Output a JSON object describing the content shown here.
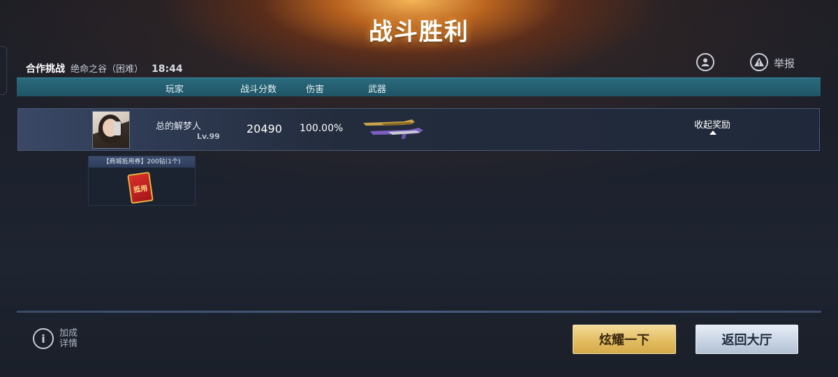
{
  "header": {
    "title": "战斗胜利",
    "mode": "合作挑战",
    "map": "绝命之谷（困难）",
    "time": "18:44",
    "report_label": "举报"
  },
  "columns": {
    "player": "玩家",
    "score": "战斗分数",
    "damage": "伤害",
    "weapon": "武器"
  },
  "player": {
    "name": "总的解梦人",
    "level": "Lv.99",
    "score": "20490",
    "damage": "100.00%",
    "collapse_label": "收起奖励"
  },
  "reward": {
    "title": "【商城抵用券】200钻(1个)",
    "coupon_text": "抵用"
  },
  "footer": {
    "info_label": "加成详情",
    "show_off_button": "炫耀一下",
    "lobby_button": "返回大厅"
  },
  "icons": {
    "profile": "profile-icon",
    "report": "warning-icon",
    "info": "info-icon"
  },
  "colors": {
    "header_bar": "#1f5566",
    "show_off_button": "#e3bd62",
    "lobby_button": "#c7d3e3"
  }
}
